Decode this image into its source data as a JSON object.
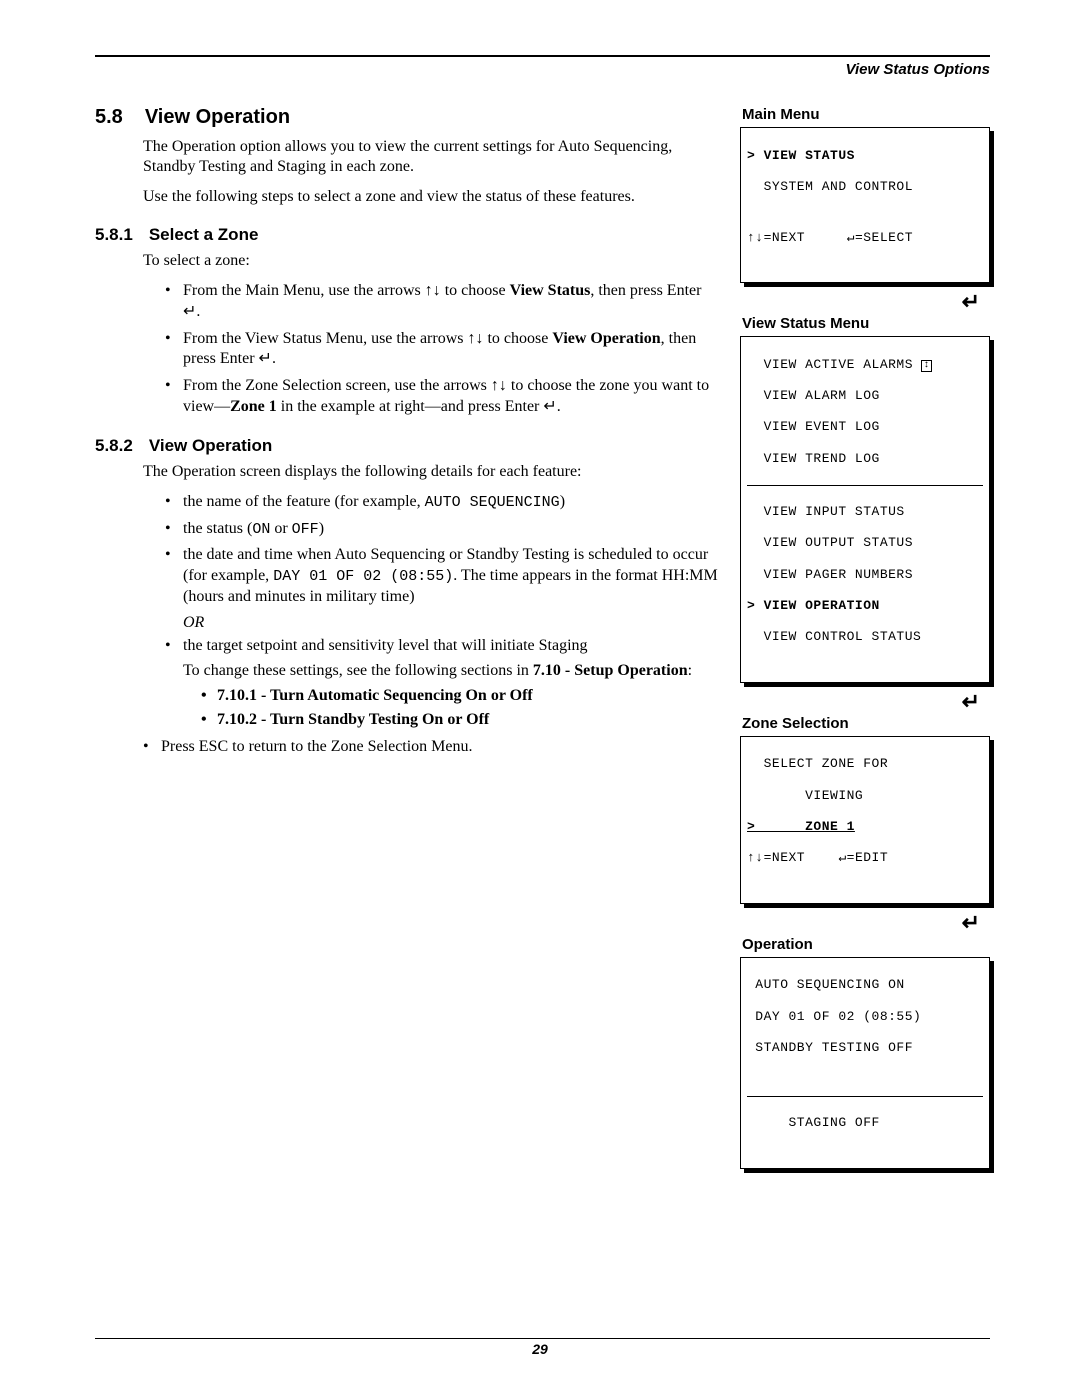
{
  "running_head": "View Status Options",
  "page_number": "29",
  "sec": {
    "num": "5.8",
    "title": "View Operation",
    "intro1": "The Operation option allows you to view the current settings for Auto Sequencing, Standby Testing and Staging in each zone.",
    "intro2": "Use the following steps to select a zone and view the status of these features."
  },
  "sub1": {
    "num": "5.8.1",
    "title": "Select a Zone",
    "lead": "To select a zone:",
    "b1a": "From the Main Menu, use the arrows ↑↓ to choose ",
    "b1b": "View Status",
    "b1c": ", then press Enter ↵.",
    "b2a": "From the View Status Menu, use the arrows ↑↓ to choose ",
    "b2b": "View Operation",
    "b2c": ", then press Enter ↵.",
    "b3a": "From the Zone Selection screen, use the arrows ↑↓ to choose the zone you want to view—",
    "b3b": "Zone 1",
    "b3c": " in the example at right—and press Enter ↵."
  },
  "sub2": {
    "num": "5.8.2",
    "title": "View Operation",
    "lead": "The Operation screen displays the following details for each feature:",
    "b1a": "the name of the feature (for example, ",
    "b1m": "AUTO SEQUENCING",
    "b1b": ")",
    "b2a": "the status (",
    "b2m1": "ON",
    "b2mid": " or ",
    "b2m2": "OFF",
    "b2b": ")",
    "b3a": "the date and time when Auto Sequencing or Standby Testing is scheduled to occur (for example, ",
    "b3m": "DAY 01 OF 02 (08:55)",
    "b3b": ". The time appears in the format HH:MM (hours and minutes in military time)",
    "or": "OR",
    "b4": "the target setpoint and sensitivity level that will initiate Staging",
    "change_a": "To change these settings, see the following sections in ",
    "change_b": "7.10 - Setup Operation",
    "change_c": ":",
    "s1": "7.10.1 - Turn Automatic Sequencing On or Off",
    "s2": "7.10.2 - Turn Standby Testing On or Off",
    "b5": "Press ESC to return to the Zone Selection Menu."
  },
  "enter_glyph": "↵",
  "screens": {
    "main": {
      "label": "Main Menu",
      "l1": "> VIEW STATUS",
      "l2": "  SYSTEM AND CONTROL",
      "nav": "↑↓=NEXT     ↵=SELECT"
    },
    "vs": {
      "label": "View Status Menu",
      "l1": "  VIEW ACTIVE ALARMS",
      "l2": "  VIEW ALARM LOG",
      "l3": "  VIEW EVENT LOG",
      "l4": "  VIEW TREND LOG",
      "l5": "  VIEW INPUT STATUS",
      "l6": "  VIEW OUTPUT STATUS",
      "l7": "  VIEW PAGER NUMBERS",
      "l8": "> VIEW OPERATION",
      "l9": "  VIEW CONTROL STATUS"
    },
    "zone": {
      "label": "Zone Selection",
      "l1": "  SELECT ZONE FOR",
      "l2": "       VIEWING",
      "l3": ">      ZONE 1",
      "nav": "↑↓=NEXT    ↵=EDIT"
    },
    "op": {
      "label": "Operation",
      "l1": " AUTO SEQUENCING ON",
      "l2": " DAY 01 OF 02 (08:55)",
      "l3": " STANDBY TESTING OFF",
      "l4": "     STAGING OFF"
    }
  }
}
